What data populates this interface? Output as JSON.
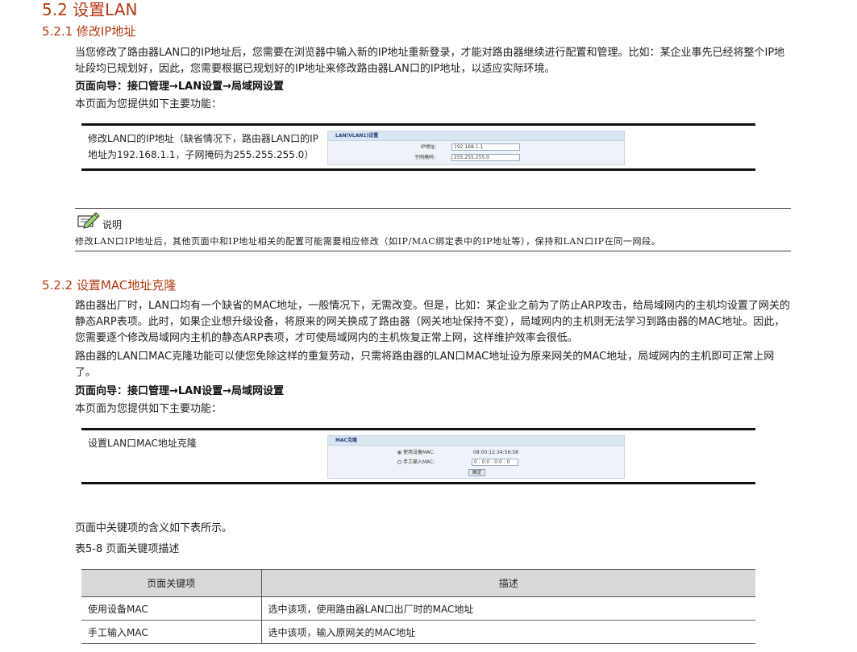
{
  "section": {
    "title": "5.2  设置LAN"
  },
  "sub1": {
    "title": "5.2.1  修改IP地址",
    "para": "当您修改了路由器LAN口的IP地址后，您需要在浏览器中输入新的IP地址重新登录，才能对路由器继续进行配置和管理。比如：某企业事先已经将整个IP地址段均已规划好，因此，您需要根据已规划好的IP地址来修改路由器LAN口的IP地址，以适应实际环境。",
    "nav": "页面向导：接口管理→LAN设置→局域网设置",
    "intro": "本页面为您提供如下主要功能：",
    "func_desc": "修改LAN口的IP地址（缺省情况下，路由器LAN口的IP地址为192.168.1.1，子网掩码为255.255.255.0）",
    "shot": {
      "header": "LAN(VLAN1)设置",
      "ip_label": "IP地址:",
      "ip_value": "192.168.1.1",
      "mask_label": "子网掩码:",
      "mask_value": "255.255.255.0"
    }
  },
  "note": {
    "title": "说明",
    "text": "修改LAN口IP地址后，其他页面中和IP地址相关的配置可能需要相应修改（如IP/MAC绑定表中的IP地址等），保持和LAN口IP在同一网段。"
  },
  "sub2": {
    "title": "5.2.2  设置MAC地址克隆",
    "para1": "路由器出厂时，LAN口均有一个缺省的MAC地址，一般情况下，无需改变。但是，比如：某企业之前为了防止ARP攻击，给局域网内的主机均设置了网关的静态ARP表项。此时，如果企业想升级设备，将原来的网关换成了路由器（网关地址保持不变），局域网内的主机则无法学习到路由器的MAC地址。因此，您需要逐个修改局域网内主机的静态ARP表项，才可使局域网内的主机恢复正常上网，这样维护效率会很低。",
    "para2": "路由器的LAN口MAC克隆功能可以使您免除这样的重复劳动，只需将路由器的LAN口MAC地址设为原来网关的MAC地址，局域网内的主机即可正常上网了。",
    "nav": "页面向导：接口管理→LAN设置→局域网设置",
    "intro": "本页面为您提供如下主要功能：",
    "func_desc": "设置LAN口MAC地址克隆",
    "shot": {
      "header": "MAC克隆",
      "opt1_label": "使用设备MAC:",
      "opt1_value": "08:00:12:34:56:58",
      "opt2_label": "手工输入MAC:",
      "opt2_value": "0 : 0:0 : 0:0 : 0",
      "button": "确定"
    }
  },
  "table_intro": "页面中关键项的含义如下表所示。",
  "table_caption": "表5-8 页面关键项描述",
  "key_table": {
    "headers": [
      "页面关键项",
      "描述"
    ],
    "rows": [
      [
        "使用设备MAC",
        "选中该项，使用路由器LAN口出厂时的MAC地址"
      ],
      [
        "手工输入MAC",
        "选中该项，输入原网关的MAC地址"
      ]
    ]
  }
}
